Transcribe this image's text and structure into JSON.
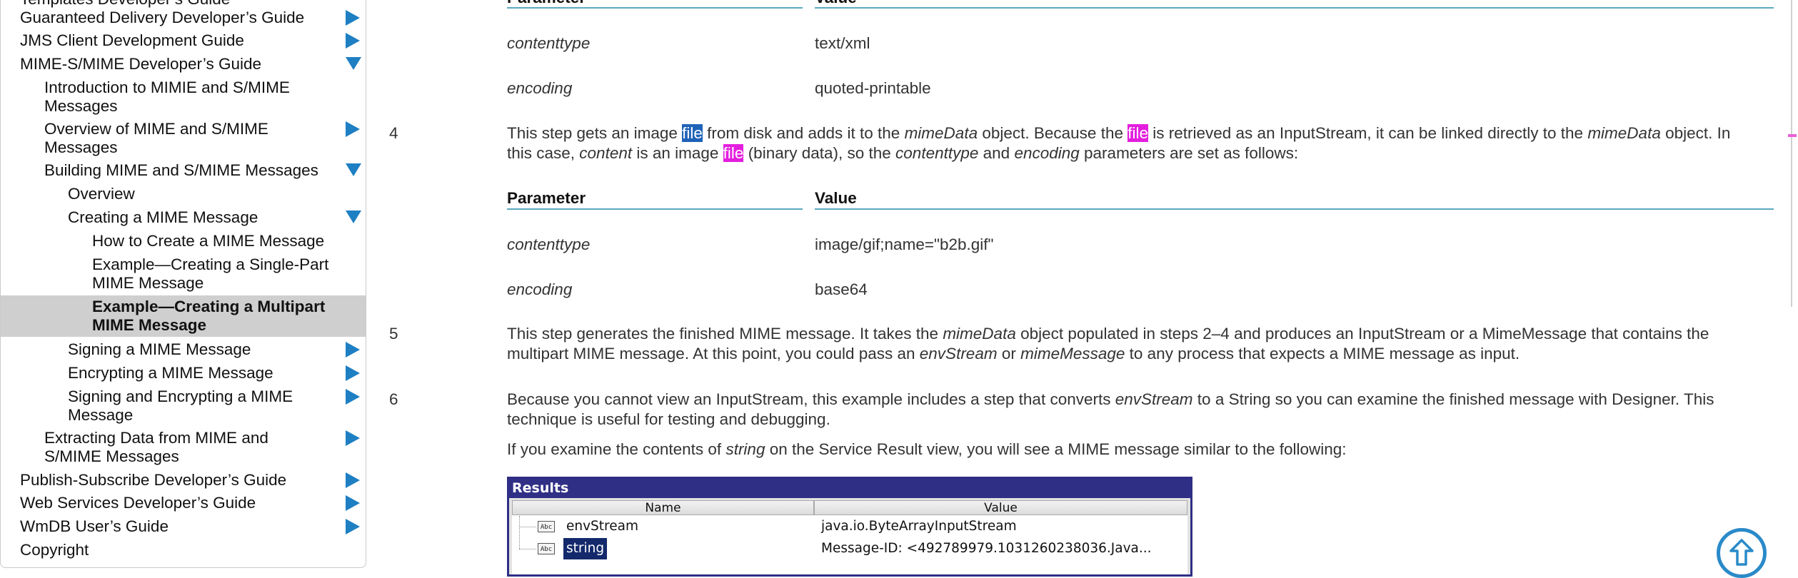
{
  "sidebar": {
    "items": [
      {
        "label": "Templates Developer’s Guide",
        "arrow": "none"
      },
      {
        "label": "Guaranteed Delivery Developer’s Guide",
        "arrow": "right"
      },
      {
        "label": "JMS Client Development Guide",
        "arrow": "right"
      },
      {
        "label": "MIME-S/MIME Developer’s Guide",
        "arrow": "down"
      },
      {
        "label": "Introduction to MIMIE and S/MIME Messages",
        "arrow": "none"
      },
      {
        "label": "Overview of MIME and S/MIME Messages",
        "arrow": "right"
      },
      {
        "label": "Building MIME and S/MIME Messages",
        "arrow": "down"
      },
      {
        "label": "Overview",
        "arrow": "none"
      },
      {
        "label": "Creating a MIME Message",
        "arrow": "down"
      },
      {
        "label": "How to Create a MIME Message",
        "arrow": "none"
      },
      {
        "label": "Example—Creating a Single-Part MIME Message",
        "arrow": "none"
      },
      {
        "label": "Example—Creating a Multipart MIME Message",
        "arrow": "none",
        "selected": true
      },
      {
        "label": "Signing a MIME Message",
        "arrow": "right"
      },
      {
        "label": "Encrypting a MIME Message",
        "arrow": "right"
      },
      {
        "label": "Signing and Encrypting a MIME Message",
        "arrow": "right"
      },
      {
        "label": "Extracting Data from MIME and S/MIME Messages",
        "arrow": "right"
      },
      {
        "label": "Publish-Subscribe Developer’s Guide",
        "arrow": "right"
      },
      {
        "label": "Web Services Developer’s Guide",
        "arrow": "right"
      },
      {
        "label": "WmDB User’s Guide",
        "arrow": "right"
      },
      {
        "label": "Copyright",
        "arrow": "none"
      }
    ]
  },
  "table1": {
    "header_param": "Parameter",
    "header_value": "Value",
    "rows": [
      {
        "param": "contenttype",
        "value": "text/xml"
      },
      {
        "param": "encoding",
        "value": "quoted-printable"
      }
    ]
  },
  "step4": {
    "num": "4",
    "line1": {
      "t1": "This step gets an image ",
      "hl1": "file",
      "t2": " from disk and adds it to the ",
      "i1": "mimeData",
      "t3": " object. Because the ",
      "hl2": "file",
      "t4": " is retrieved as an InputStream, it can be linked directly to the ",
      "i2": "mimeData",
      "t5": " object. In"
    },
    "line2": {
      "t1": "this case, ",
      "i1": "content",
      "t2": " is an image ",
      "hl1": "file",
      "t3": " (binary data), so the ",
      "i2": "contenttype",
      "t4": " and ",
      "i3": "encoding",
      "t5": " parameters are set as follows:"
    }
  },
  "table2": {
    "header_param": "Parameter",
    "header_value": "Value",
    "rows": [
      {
        "param": "contenttype",
        "value": "image/gif;name=\"b2b.gif\""
      },
      {
        "param": "encoding",
        "value": "base64"
      }
    ]
  },
  "step5": {
    "num": "5",
    "line1": {
      "t1": "This step generates the finished MIME message. It takes the ",
      "i1": "mimeData",
      "t2": " object populated in steps 2–4 and produces an InputStream or a MimeMessage that contains the"
    },
    "line2": {
      "t1": "multipart MIME message. At this point, you could pass an ",
      "i1": "envStream",
      "t2": " or ",
      "i2": "mimeMessage",
      "t3": " to any process that expects a MIME message as input."
    }
  },
  "step6": {
    "num": "6",
    "line1": {
      "t1": "Because you cannot view an InputStream, this example includes a step that converts ",
      "i1": "envStream",
      "t2": " to a String so you can examine the finished message with Designer. This"
    },
    "line2": "technique is useful for testing and debugging.",
    "line3": {
      "t1": "If you examine the contents of ",
      "i1": "string",
      "t2": " on the Service Result view, you will see a MIME message similar to the following:"
    }
  },
  "results": {
    "title": "Results",
    "col_name": "Name",
    "col_value": "Value",
    "rows": [
      {
        "icon": "abc-icon",
        "name": "envStream",
        "value": "java.io.ByteArrayInputStream",
        "selected": false
      },
      {
        "icon": "abc-icon",
        "name": "string",
        "value": "Message-ID: <492789979.1031260238036.Java...",
        "selected": true
      }
    ]
  },
  "back_to_top": {
    "icon": "arrow-up-circle-icon"
  },
  "colors": {
    "accent": "#1e7fc3",
    "selection": "#cfcfcf",
    "search_current": "#1f63b8",
    "search_match": "#e41ede",
    "results_header": "#2f2f86",
    "rule": "#5aa9c2"
  }
}
